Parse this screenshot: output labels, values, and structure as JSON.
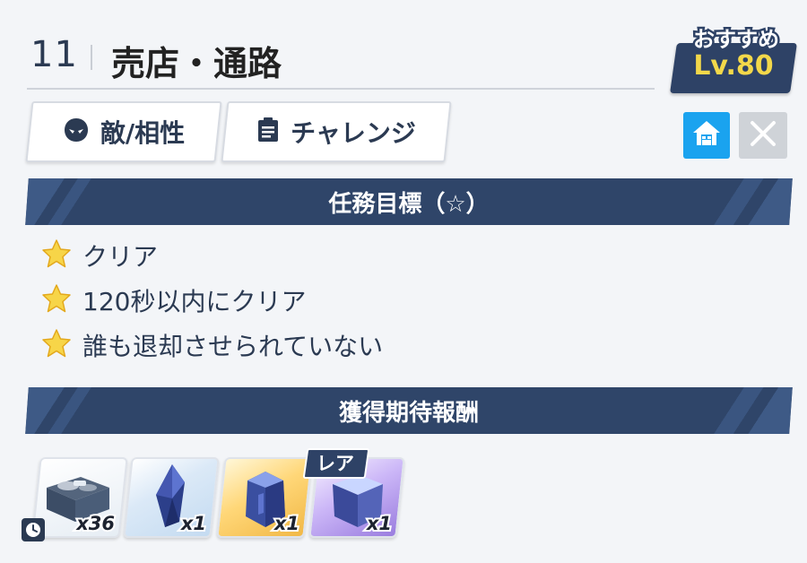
{
  "header": {
    "stage_number": "11",
    "stage_title": "売店・通路"
  },
  "recommend": {
    "label": "おすすめ",
    "level": "Lv.80"
  },
  "tabs": [
    {
      "label": "敵/相性",
      "icon": "enemy-face-icon"
    },
    {
      "label": "チャレンジ",
      "icon": "clipboard-icon"
    }
  ],
  "buttons": {
    "home_icon": "home-icon",
    "close_icon": "close-icon"
  },
  "objectives": {
    "title": "任務目標（☆）",
    "items": [
      {
        "text": "クリア",
        "icon": "star-icon"
      },
      {
        "text": "120秒以内にクリア",
        "icon": "star-icon"
      },
      {
        "text": "誰も退却させられていない",
        "icon": "star-icon"
      }
    ]
  },
  "rewards": {
    "title": "獲得期待報酬",
    "items": [
      {
        "quantity": "x36",
        "icon": "material-box-icon"
      },
      {
        "quantity": "x1",
        "icon": "blue-crystal-icon"
      },
      {
        "quantity": "x1",
        "icon": "blue-ore-icon"
      },
      {
        "quantity": "x1",
        "icon": "purple-cube-icon",
        "badge": "レア"
      }
    ]
  },
  "colors": {
    "navy": "#2e4266",
    "banner": "#2f4569",
    "accent_blue": "#1aa3ef",
    "level_yellow": "#f3d84a",
    "star_yellow": "#f7d548"
  }
}
